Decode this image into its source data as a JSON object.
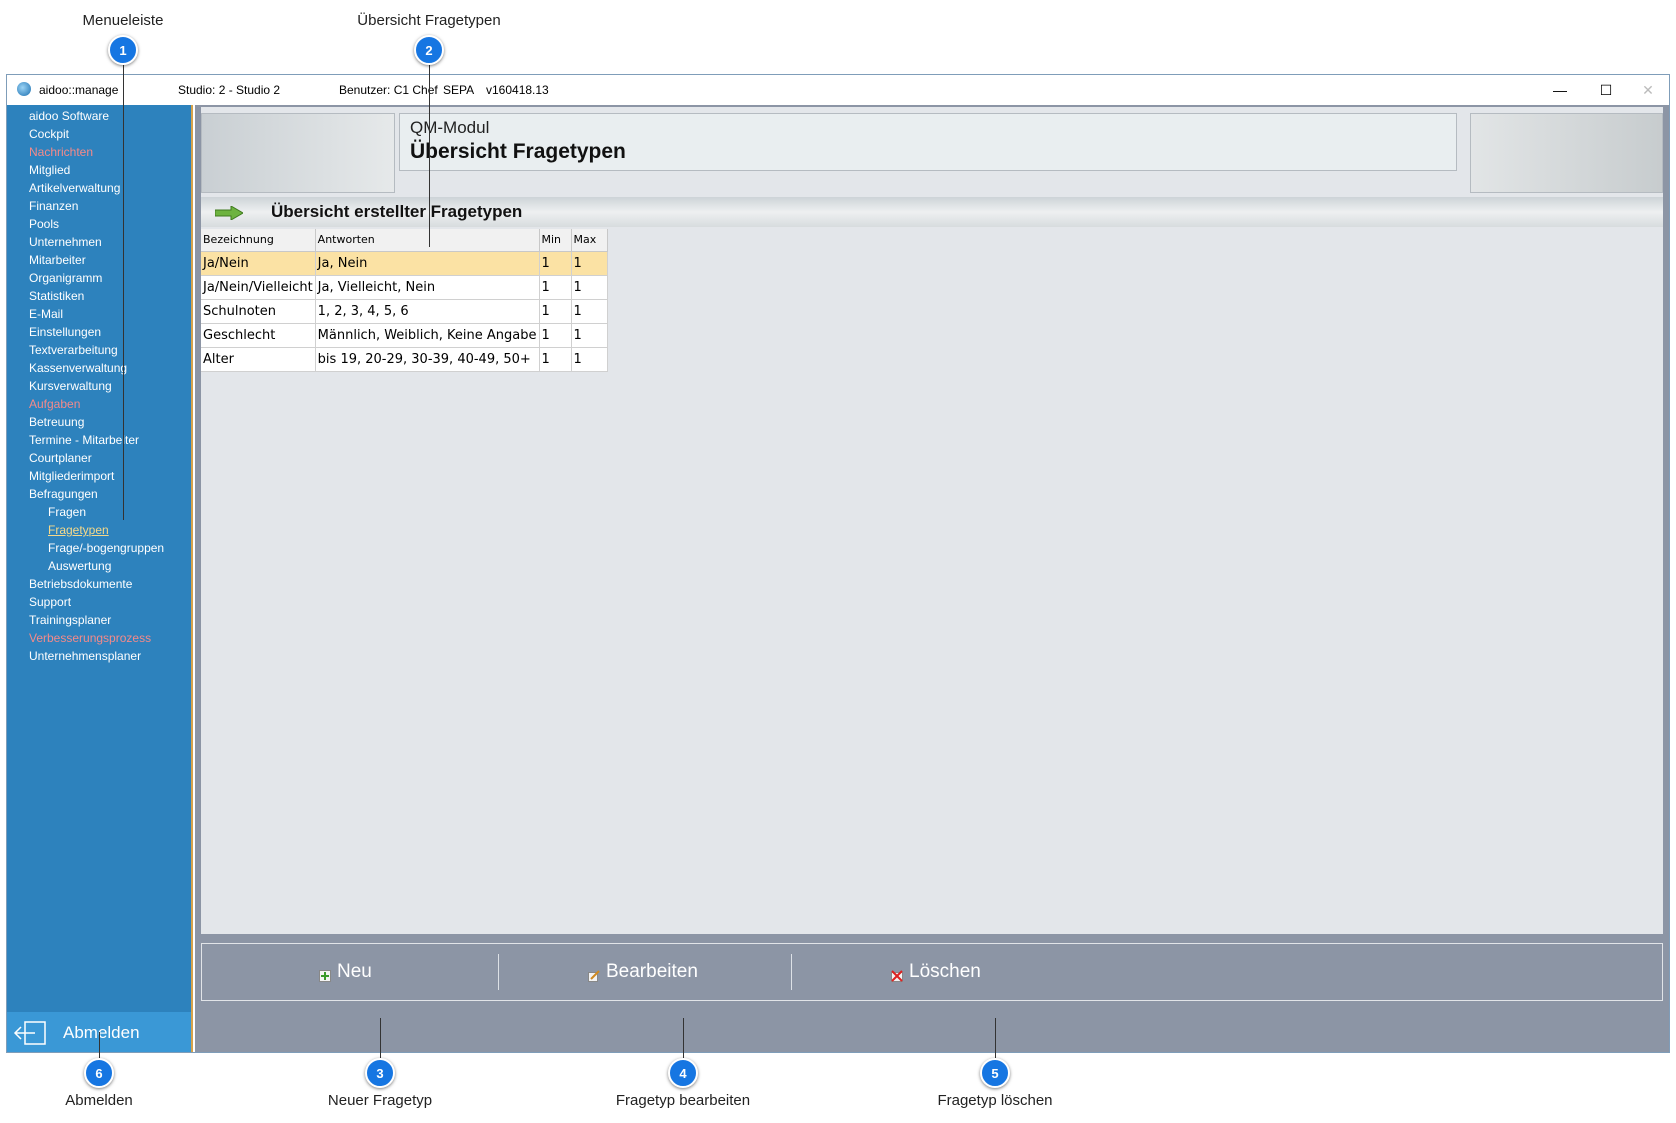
{
  "annotations": [
    {
      "num": "1",
      "label": "Menueleiste"
    },
    {
      "num": "2",
      "label": "Übersicht Fragetypen"
    },
    {
      "num": "3",
      "label": "Neuer Fragetyp"
    },
    {
      "num": "4",
      "label": "Fragetyp bearbeiten"
    },
    {
      "num": "5",
      "label": "Fragetyp löschen"
    },
    {
      "num": "6",
      "label": "Abmelden"
    }
  ],
  "titlebar": {
    "app": "aidoo::manage",
    "studio": "Studio: 2 - Studio 2",
    "user": "Benutzer: C1 Chef",
    "sepa": "SEPA",
    "version": "v160418.13",
    "minimize": "—",
    "maximize": "☐",
    "close": "✕"
  },
  "sidebar": {
    "items": [
      {
        "label": "aidoo Software"
      },
      {
        "label": "Cockpit"
      },
      {
        "label": "Nachrichten"
      },
      {
        "label": "Mitglied"
      },
      {
        "label": "Artikelverwaltung"
      },
      {
        "label": "Finanzen"
      },
      {
        "label": "Pools"
      },
      {
        "label": "Unternehmen"
      },
      {
        "label": "Mitarbeiter"
      },
      {
        "label": "Organigramm"
      },
      {
        "label": "Statistiken"
      },
      {
        "label": "E-Mail"
      },
      {
        "label": "Einstellungen"
      },
      {
        "label": "Textverarbeitung"
      },
      {
        "label": "Kassenverwaltung"
      },
      {
        "label": "Kursverwaltung"
      },
      {
        "label": "Aufgaben"
      },
      {
        "label": "Betreuung"
      },
      {
        "label": "Termine - Mitarbeiter"
      },
      {
        "label": "Courtplaner"
      },
      {
        "label": "Mitgliederimport"
      },
      {
        "label": "Befragungen"
      },
      {
        "label": "Fragen"
      },
      {
        "label": "Fragetypen"
      },
      {
        "label": "Frage/-bogengruppen"
      },
      {
        "label": "Auswertung"
      },
      {
        "label": "Betriebsdokumente"
      },
      {
        "label": "Support"
      },
      {
        "label": "Trainingsplaner"
      },
      {
        "label": "Verbesserungsprozess"
      },
      {
        "label": "Unternehmensplaner"
      }
    ],
    "logout_label": "Abmelden"
  },
  "header": {
    "module": "QM-Modul",
    "title": "Übersicht Fragetypen"
  },
  "section": {
    "title": "Übersicht erstellter Fragetypen"
  },
  "table": {
    "columns": [
      "Bezeichnung",
      "Antworten",
      "Min",
      "Max"
    ],
    "rows": [
      [
        "Ja/Nein",
        "Ja, Nein",
        "1",
        "1"
      ],
      [
        "Ja/Nein/Vielleicht",
        "Ja, Vielleicht, Nein",
        "1",
        "1"
      ],
      [
        "Schulnoten",
        "1, 2, 3, 4, 5, 6",
        "1",
        "1"
      ],
      [
        "Geschlecht",
        "Männlich, Weiblich, Keine Angabe",
        "1",
        "1"
      ],
      [
        "Alter",
        "bis 19, 20-29, 30-39, 40-49, 50+",
        "1",
        "1"
      ]
    ],
    "selected_row": 0
  },
  "toolbar": {
    "new_label": "Neu",
    "edit_label": "Bearbeiten",
    "delete_label": "Löschen"
  },
  "colors": {
    "sidebar": "#2d82bd",
    "sidebar_highlight": "#f48a8a",
    "selected_row": "#fbe2a4",
    "badge": "#1676e2"
  }
}
